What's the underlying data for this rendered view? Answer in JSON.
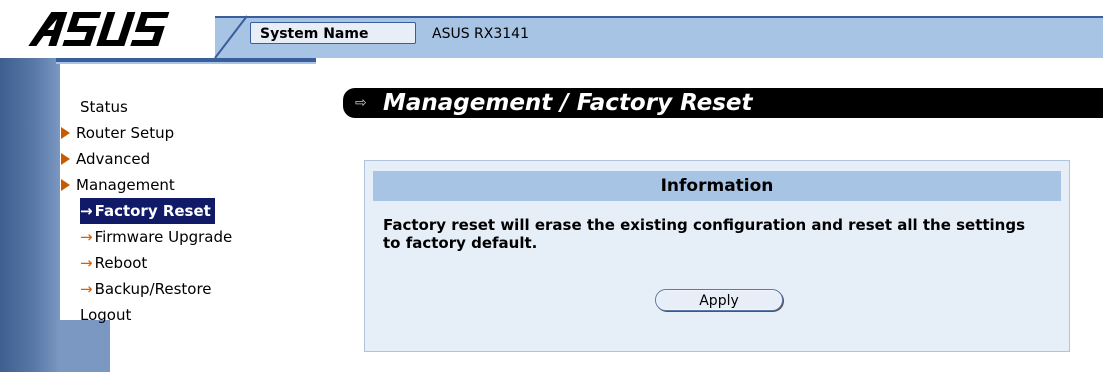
{
  "header": {
    "logo_text": "ASUS",
    "system_name_label": "System Name",
    "system_name_value": "ASUS RX3141"
  },
  "sidebar": {
    "items": [
      {
        "label": "Status",
        "arrow": false
      },
      {
        "label": "Router Setup",
        "arrow": true
      },
      {
        "label": "Advanced",
        "arrow": true
      },
      {
        "label": "Management",
        "arrow": true
      }
    ],
    "sub_items": [
      {
        "label": "Factory Reset",
        "active": true
      },
      {
        "label": "Firmware Upgrade",
        "active": false
      },
      {
        "label": "Reboot",
        "active": false
      },
      {
        "label": "Backup/Restore",
        "active": false
      }
    ],
    "logout": "Logout",
    "sub_arrow": "→"
  },
  "main": {
    "title_icon": "⇨",
    "title": "Management / Factory Reset",
    "panel_heading": "Information",
    "panel_text": "Factory reset will erase the existing configuration and reset all the settings to factory default.",
    "apply_label": "Apply"
  },
  "colors": {
    "topbar": "#a8c4e4",
    "accent": "#3a5e9c",
    "active_bg": "#111a66",
    "panel_bg": "#e6eef8"
  }
}
